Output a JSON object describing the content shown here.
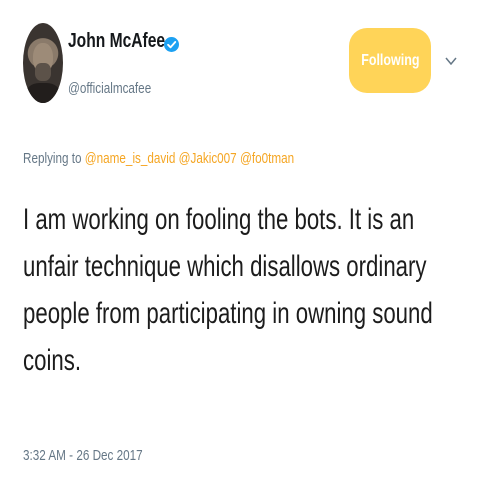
{
  "author": {
    "name": "John McAfee",
    "handle": "@officialmcafee",
    "verified": true
  },
  "follow_button": {
    "label": "Following",
    "color": "#ffd458"
  },
  "menu": {
    "icon": "chevron-down-icon"
  },
  "reply": {
    "prefix": "Replying to",
    "mentions": [
      "@name_is_david",
      "@Jakic007",
      "@fo0tman"
    ],
    "mention_color": "#f5a623"
  },
  "tweet": {
    "lines": [
      "I am working on fooling the bots. It is an",
      "unfair technique which disallows ordinary",
      "people from participating in owning sound",
      "coins."
    ]
  },
  "timestamp": "3:32 AM - 26 Dec 2017"
}
